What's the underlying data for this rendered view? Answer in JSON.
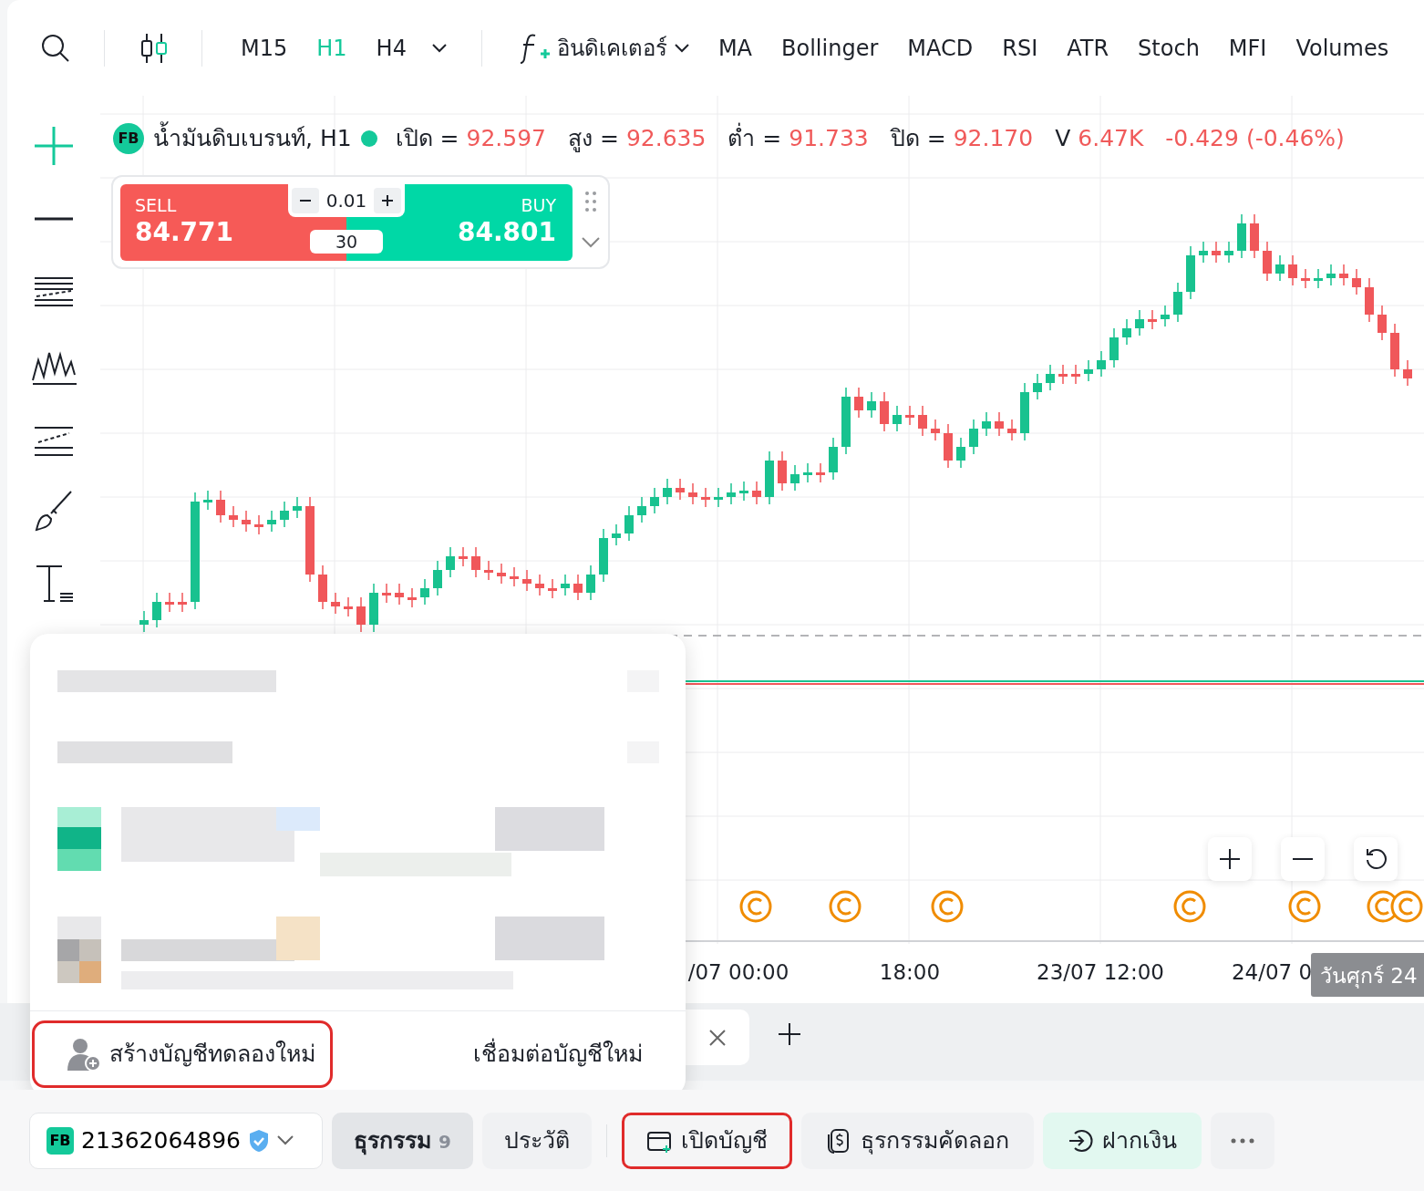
{
  "toolbar": {
    "timeframes": [
      {
        "label": "M15",
        "selected": false
      },
      {
        "label": "H1",
        "selected": true
      },
      {
        "label": "H4",
        "selected": false
      }
    ],
    "indicators_menu": "อินดิเคเตอร์",
    "indicators": [
      "MA",
      "Bollinger",
      "MACD",
      "RSI",
      "ATR",
      "Stoch",
      "MFI",
      "Volumes"
    ]
  },
  "legend": {
    "badge": "FB",
    "symbol": "น้ำมันดิบเบรนท์, H1",
    "fields": [
      {
        "label": "เปิด =",
        "value": "92.597"
      },
      {
        "label": "สูง =",
        "value": "92.635"
      },
      {
        "label": "ต่ำ =",
        "value": "91.733"
      },
      {
        "label": "ปิด =",
        "value": "92.170"
      },
      {
        "label": "V",
        "value": "6.47K"
      }
    ],
    "change": "-0.429 (-0.46%)"
  },
  "trade_panel": {
    "sell_label": "SELL",
    "sell_price": "84.771",
    "buy_label": "BUY",
    "buy_price": "84.801",
    "lot": "0.01",
    "spread": "30"
  },
  "chart": {
    "x_axis_labels": [
      "/07 00:00",
      "18:00",
      "23/07 12:00",
      "24/07 0"
    ],
    "crosshair_date": "วันศุกร์ 24"
  },
  "account_menu": {
    "footer": [
      {
        "kind": "create-demo",
        "label": "สร้างบัญชีทดลองใหม่",
        "highlighted": true
      },
      {
        "kind": "connect",
        "label": "เชื่อมต่อบัญชีใหม่",
        "highlighted": false
      }
    ]
  },
  "bottom_bar": {
    "account": {
      "badge": "FB",
      "number": "21362064896",
      "verified": true
    },
    "tabs": [
      {
        "label": "ธุรกรรม",
        "count": "9",
        "selected": true
      },
      {
        "label": "ประวัติ",
        "selected": false
      }
    ],
    "actions": [
      {
        "kind": "open-account",
        "label": "เปิดบัญชี",
        "highlighted": true
      },
      {
        "kind": "copy-trade",
        "label": "ธุรกรรมคัดลอก",
        "highlighted": false
      },
      {
        "kind": "deposit",
        "label": "ฝากเงิน",
        "highlighted": false
      }
    ]
  }
}
